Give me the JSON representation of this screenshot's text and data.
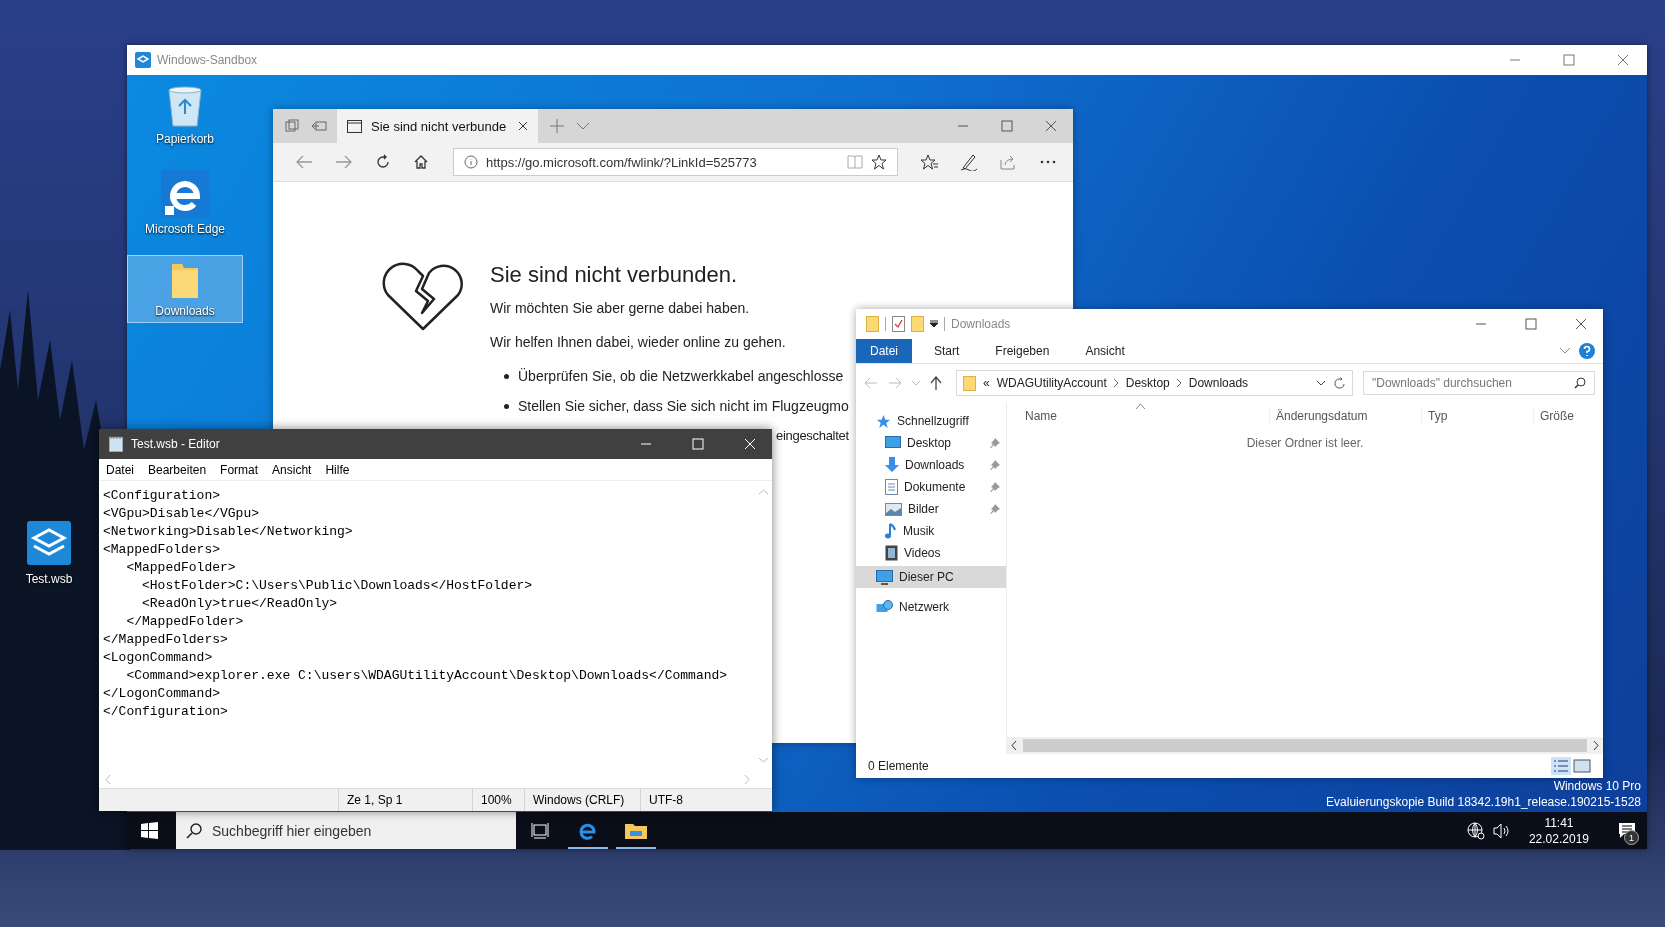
{
  "host_desktop_icons": [
    {
      "label": "Test.wsb"
    }
  ],
  "sandbox_window": {
    "title": "Windows-Sandbox"
  },
  "desktop_icons": [
    {
      "label": "Papierkorb",
      "kind": "recycle",
      "selected": false
    },
    {
      "label": "Microsoft Edge",
      "kind": "edge",
      "selected": false
    },
    {
      "label": "Downloads",
      "kind": "folder",
      "selected": true
    }
  ],
  "browser": {
    "tab_title": "Sie sind nicht verbunde",
    "address": "https://go.microsoft.com/fwlink/?LinkId=525773",
    "heading": "Sie sind nicht verbunden.",
    "paragraphs": [
      "Wir möchten Sie aber gerne dabei haben.",
      "Wir helfen Ihnen dabei, wieder online zu gehen."
    ],
    "bullets": [
      "Überprüfen Sie, ob die Netzwerkkabel angeschlosse",
      "Stellen Sie sicher, dass Sie sich nicht im Flugzeugmo"
    ],
    "continuation": "eingeschaltet"
  },
  "explorer": {
    "title": "Downloads",
    "ribbon_tabs": [
      {
        "label": "Datei",
        "kind": "file"
      },
      {
        "label": "Start",
        "kind": "tab"
      },
      {
        "label": "Freigeben",
        "kind": "tab"
      },
      {
        "label": "Ansicht",
        "kind": "tab"
      }
    ],
    "breadcrumb_prefix": "«",
    "breadcrumb": [
      "WDAGUtilityAccount",
      "Desktop",
      "Downloads"
    ],
    "search": {
      "placeholder": "\"Downloads\" durchsuchen"
    },
    "nav": [
      {
        "label": "Schnellzugriff",
        "kind": "star",
        "selected": false,
        "children": [
          {
            "label": "Desktop",
            "kind": "desktop",
            "selected": false,
            "pinned": true
          },
          {
            "label": "Downloads",
            "kind": "download",
            "selected": false,
            "pinned": true
          },
          {
            "label": "Dokumente",
            "kind": "document",
            "selected": false,
            "pinned": true
          },
          {
            "label": "Bilder",
            "kind": "picture",
            "selected": false,
            "pinned": true
          },
          {
            "label": "Musik",
            "kind": "music",
            "selected": false,
            "pinned": false
          },
          {
            "label": "Videos",
            "kind": "video",
            "selected": false,
            "pinned": false
          }
        ]
      },
      {
        "label": "Dieser PC",
        "kind": "pc",
        "selected": true
      },
      {
        "label": "Netzwerk",
        "kind": "network",
        "selected": false
      }
    ],
    "columns": [
      "Name",
      "Änderungsdatum",
      "Typ",
      "Größe"
    ],
    "empty_message": "Dieser Ordner ist leer.",
    "status": "0 Elemente"
  },
  "notepad": {
    "title": "Test.wsb - Editor",
    "menu": [
      "Datei",
      "Bearbeiten",
      "Format",
      "Ansicht",
      "Hilfe"
    ],
    "lines": [
      "<Configuration>",
      "<VGpu>Disable</VGpu>",
      "<Networking>Disable</Networking>",
      "<MappedFolders>",
      "   <MappedFolder>",
      "     <HostFolder>C:\\Users\\Public\\Downloads</HostFolder>",
      "     <ReadOnly>true</ReadOnly>",
      "   </MappedFolder>",
      "</MappedFolders>",
      "<LogonCommand>",
      "   <Command>explorer.exe C:\\users\\WDAGUtilityAccount\\Desktop\\Downloads</Command>",
      "</LogonCommand>",
      "</Configuration>"
    ],
    "status": [
      "Ze 1, Sp 1",
      "100%",
      "Windows (CRLF)",
      "UTF-8"
    ]
  },
  "edition_notice": [
    "Windows 10 Pro",
    "Evaluierungskopie Build 18342.19h1_release.190215-1528"
  ],
  "taskbar": {
    "search": {
      "placeholder": "Suchbegriff hier eingeben"
    },
    "apps": [
      {
        "kind": "taskview",
        "running": false
      },
      {
        "kind": "edge",
        "running": true
      },
      {
        "kind": "explorer",
        "running": true
      }
    ],
    "time": "11:41",
    "date": "22.02.2019",
    "notification_count": "1"
  }
}
